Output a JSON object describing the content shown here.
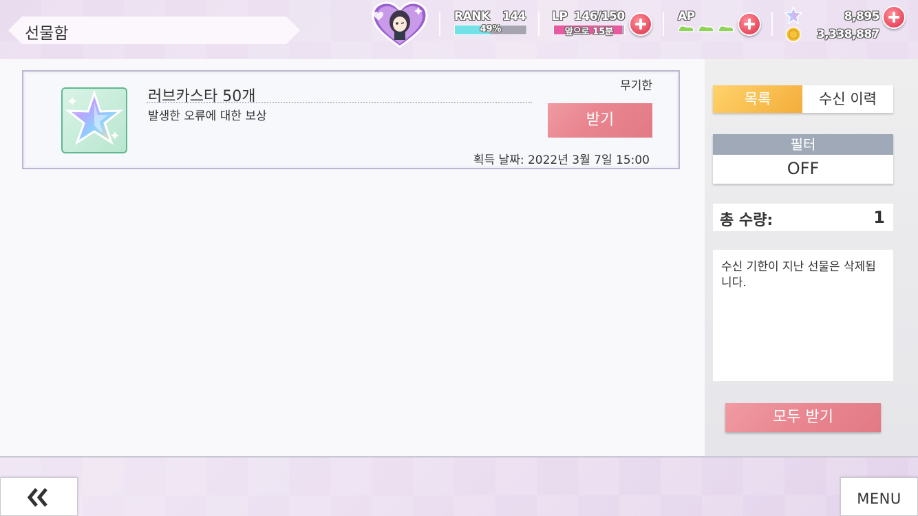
{
  "header": {
    "title": "선물함",
    "rank_label": "RANK",
    "rank_value": "144",
    "rank_progress_text": "49%",
    "rank_progress": 0.49,
    "lp_label": "LP",
    "lp_value": "146/150",
    "lp_subtext": "앞으로 15분",
    "lp_progress": 0.97,
    "ap_label": "AP",
    "ap_count": 3,
    "star_gems": "8,895",
    "gold": "3,338,887"
  },
  "gift": {
    "name": "러브카스타 50개",
    "description": "발생한 오류에 대한 보상",
    "expiry": "무기한",
    "receive_label": "받기",
    "acquired": "획득 날짜: 2022년 3월 7일 15:00",
    "icon": "love-star-icon"
  },
  "sidebar": {
    "tab_list": "목록",
    "tab_history": "수신 이력",
    "filter_label": "필터",
    "filter_value": "OFF",
    "total_label": "총 수량:",
    "total_value": "1",
    "note": "수신 기한이 지난 선물은 삭제됩니다.",
    "receive_all_label": "모두 받기"
  },
  "footer": {
    "back_icon": "double-chevron-left-icon",
    "menu_label": "MENU"
  },
  "colors": {
    "accent_pink": "#e8848e",
    "tab_active": "#f3ad3b",
    "rank_bar": "#6fe0e6",
    "lp_bar": "#e4569c",
    "filter_header": "#9fa9b8"
  }
}
